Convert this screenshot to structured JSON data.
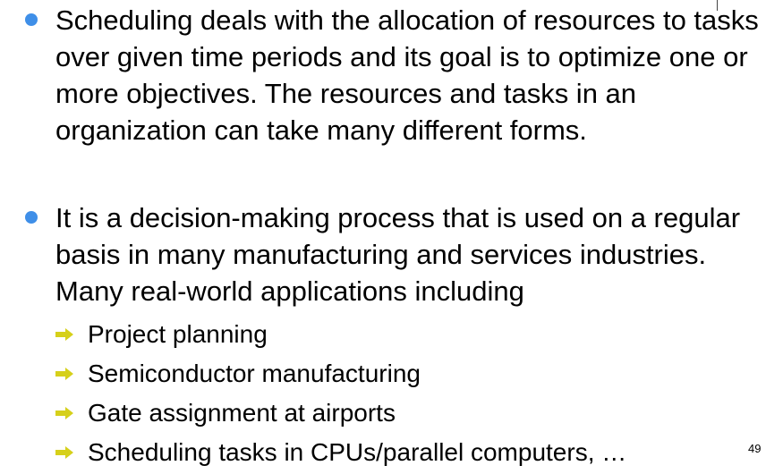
{
  "colors": {
    "bullet_dot": "#3f8fe8",
    "sub_arrow": "#d6d01a",
    "text": "#000000"
  },
  "bullets": [
    {
      "text": "Scheduling deals with the allocation of resources to tasks over given time periods and its goal is to optimize one or more objectives. The resources and tasks in an organization can take many different forms."
    },
    {
      "text": "It is a decision-making process that is used on a regular basis in many manufacturing and services industries. Many real-world applications including"
    }
  ],
  "sub_items": [
    {
      "text": "Project planning",
      "icon": "arrow-right-icon"
    },
    {
      "text": "Semiconductor manufacturing",
      "icon": "arrow-right-icon"
    },
    {
      "text": "Gate assignment at airports",
      "icon": "arrow-right-icon"
    },
    {
      "text": "Scheduling tasks in CPUs/parallel computers, …",
      "icon": "arrow-right-icon"
    }
  ],
  "page_number": "49"
}
